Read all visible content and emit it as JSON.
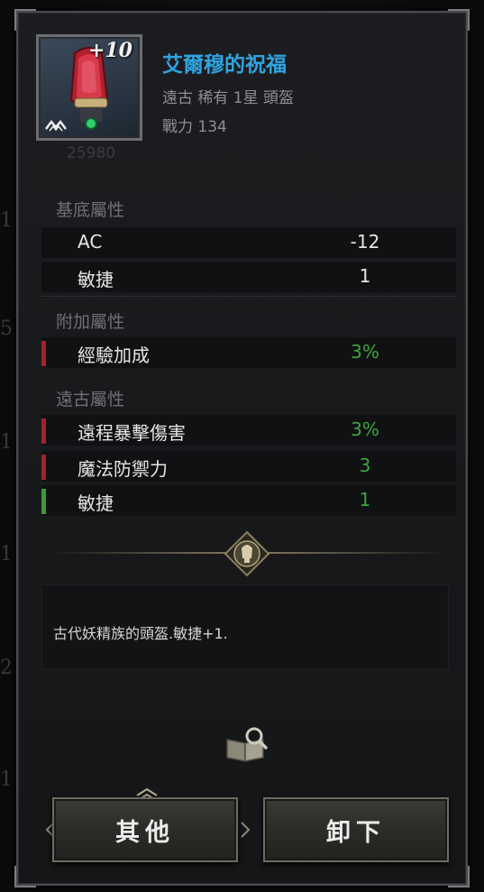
{
  "background": {
    "side_numbers": [
      "1",
      "5",
      "1",
      "1",
      "2",
      "1"
    ]
  },
  "item": {
    "enhance": "+10",
    "gear_score": "25980",
    "name": "艾爾穆的祝福",
    "meta": "遠古 稀有 1星 頭盔",
    "power": "戰力 134",
    "name_color": "#2fa4df",
    "icon": "red-helmet-icon"
  },
  "sections": {
    "base": {
      "title": "基底屬性",
      "rows": [
        {
          "name": "AC",
          "value": "-12"
        },
        {
          "name": "敏捷",
          "value": "1"
        }
      ]
    },
    "extra": {
      "title": "附加屬性",
      "rows": [
        {
          "name": "經驗加成",
          "value": "3%",
          "mark": "red"
        }
      ]
    },
    "ancient": {
      "title": "遠古屬性",
      "rows": [
        {
          "name": "遠程暴擊傷害",
          "value": "3%",
          "mark": "red"
        },
        {
          "name": "魔法防禦力",
          "value": "3",
          "mark": "red"
        },
        {
          "name": "敏捷",
          "value": "1",
          "mark": "green"
        }
      ]
    }
  },
  "colors": {
    "value_green": "#3da53d",
    "value_white": "#e6e6e6",
    "mark_red": "#a4222a",
    "mark_green": "#3a9a3a"
  },
  "description": "古代妖精族的頭盔.敏捷+1.",
  "buttons": {
    "other": "其他",
    "unequip": "卸下"
  }
}
